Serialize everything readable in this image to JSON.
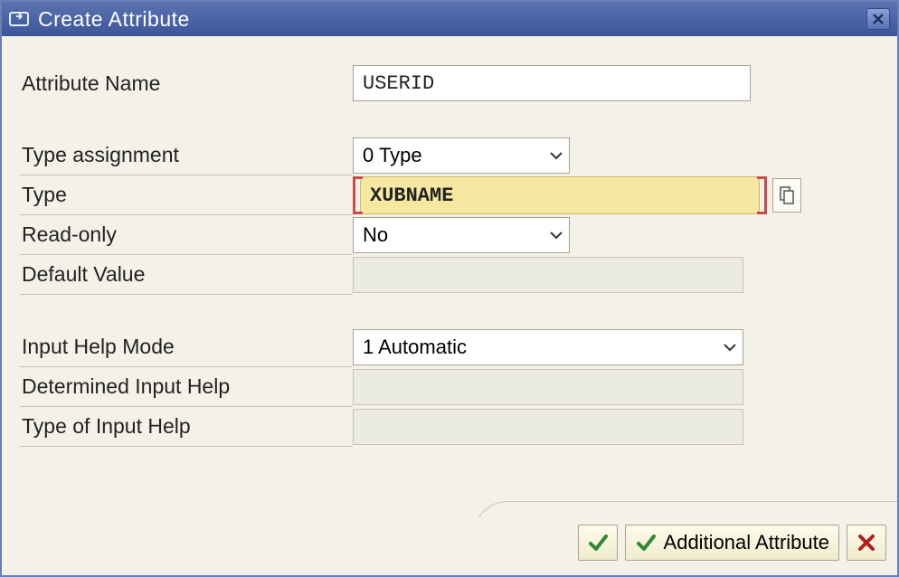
{
  "window": {
    "title": "Create Attribute"
  },
  "fields": {
    "attribute_name": {
      "label": "Attribute Name",
      "value": "USERID"
    },
    "type_assignment": {
      "label": "Type assignment",
      "value": "0 Type"
    },
    "type": {
      "label": "Type",
      "value": "XUBNAME"
    },
    "read_only": {
      "label": "Read-only",
      "value": "No"
    },
    "default_value": {
      "label": "Default Value",
      "value": ""
    },
    "input_help_mode": {
      "label": "Input Help Mode",
      "value": "1 Automatic"
    },
    "determined_input_help": {
      "label": "Determined Input Help",
      "value": ""
    },
    "type_of_input_help": {
      "label": "Type of Input Help",
      "value": ""
    }
  },
  "footer": {
    "additional_attribute": "Additional Attribute"
  }
}
